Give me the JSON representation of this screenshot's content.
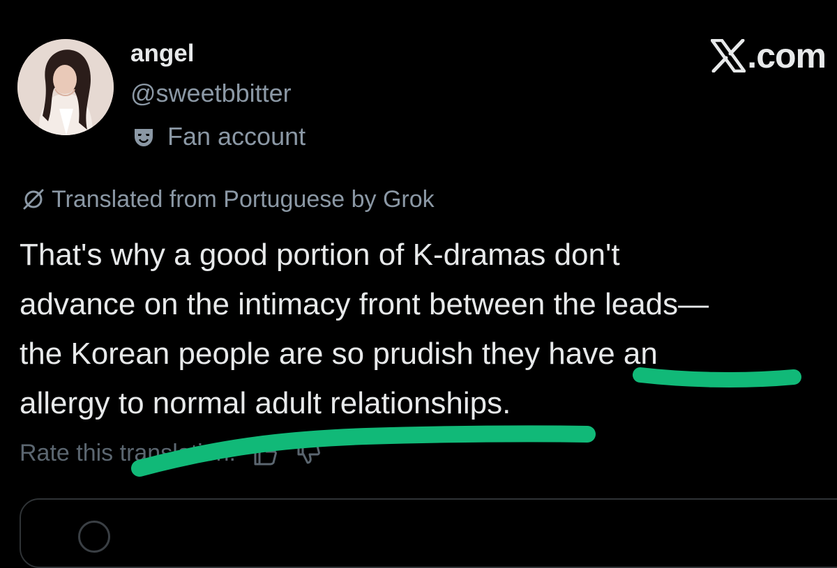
{
  "user": {
    "display_name": "angel",
    "handle": "@sweetbbitter",
    "label": "Fan account",
    "label_icon": "theater-mask-icon"
  },
  "brand": {
    "text": ".com",
    "icon": "x-logo-icon"
  },
  "translation": {
    "note": "Translated from Portuguese by Grok",
    "icon": "translate-slash-icon"
  },
  "post": {
    "lines": [
      "That's why a good portion of K-dramas don't",
      "advance on the intimacy front between the leads—",
      "the Korean people are so prudish they have an",
      "allergy to normal adult relationships."
    ]
  },
  "rate": {
    "label": "Rate this translation:",
    "thumbs_up_icon": "thumbs-up-icon",
    "thumbs_down_icon": "thumbs-down-icon"
  },
  "colors": {
    "background": "#000000",
    "text_primary": "#e7e9ea",
    "text_secondary": "#8b98a5",
    "highlight": "#11b978"
  }
}
